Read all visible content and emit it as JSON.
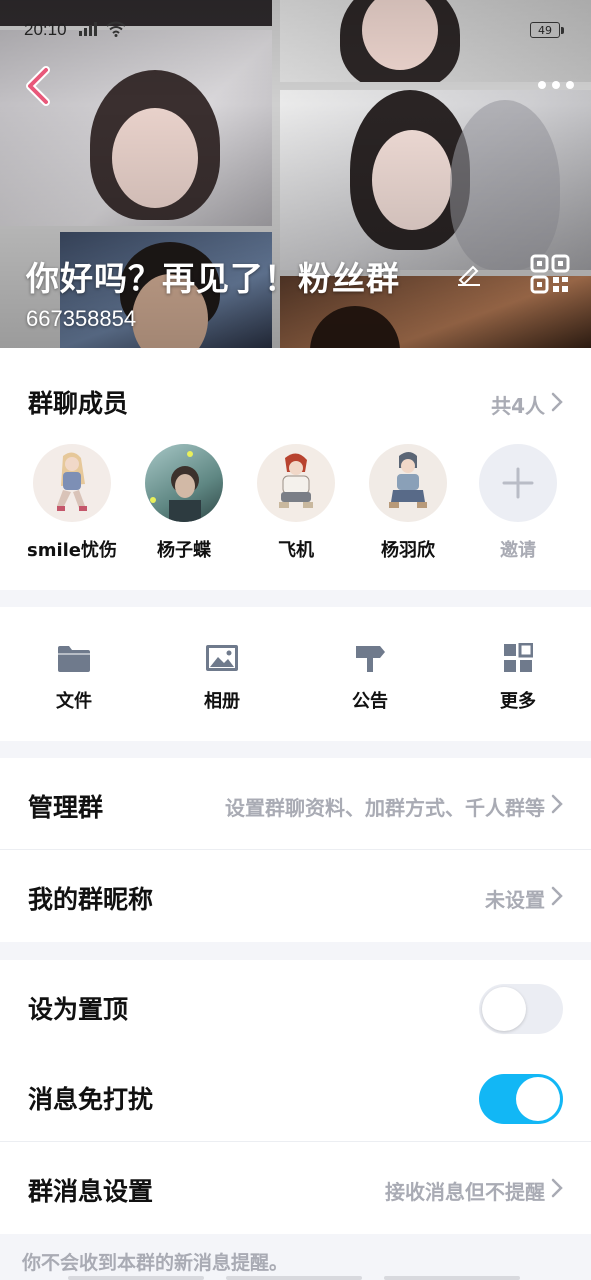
{
  "status_bar": {
    "time": "20:10",
    "battery": "49"
  },
  "header": {
    "group_name": "你好吗？再见了！粉丝群",
    "group_id": "667358854"
  },
  "members": {
    "title": "群聊成员",
    "count_label": "共4人",
    "list": [
      {
        "name": "smile忧伤"
      },
      {
        "name": "杨子蝶"
      },
      {
        "name": "飞机"
      },
      {
        "name": "杨羽欣"
      }
    ],
    "invite_label": "邀请"
  },
  "tools": [
    {
      "label": "文件",
      "icon": "folder-icon"
    },
    {
      "label": "相册",
      "icon": "image-icon"
    },
    {
      "label": "公告",
      "icon": "signpost-icon"
    },
    {
      "label": "更多",
      "icon": "grid-icon"
    }
  ],
  "settings": {
    "manage": {
      "label": "管理群",
      "value": "设置群聊资料、加群方式、千人群等"
    },
    "nickname": {
      "label": "我的群昵称",
      "value": "未设置"
    },
    "pin": {
      "label": "设为置顶",
      "on": false
    },
    "mute": {
      "label": "消息免打扰",
      "on": true
    },
    "message_settings": {
      "label": "群消息设置",
      "value": "接收消息但不提醒"
    }
  },
  "footer_note": "你不会收到本群的新消息提醒。",
  "colors": {
    "accent": "#12b7f5",
    "hint_gray": "#a9abb4",
    "back_pink": "#e8587a"
  }
}
